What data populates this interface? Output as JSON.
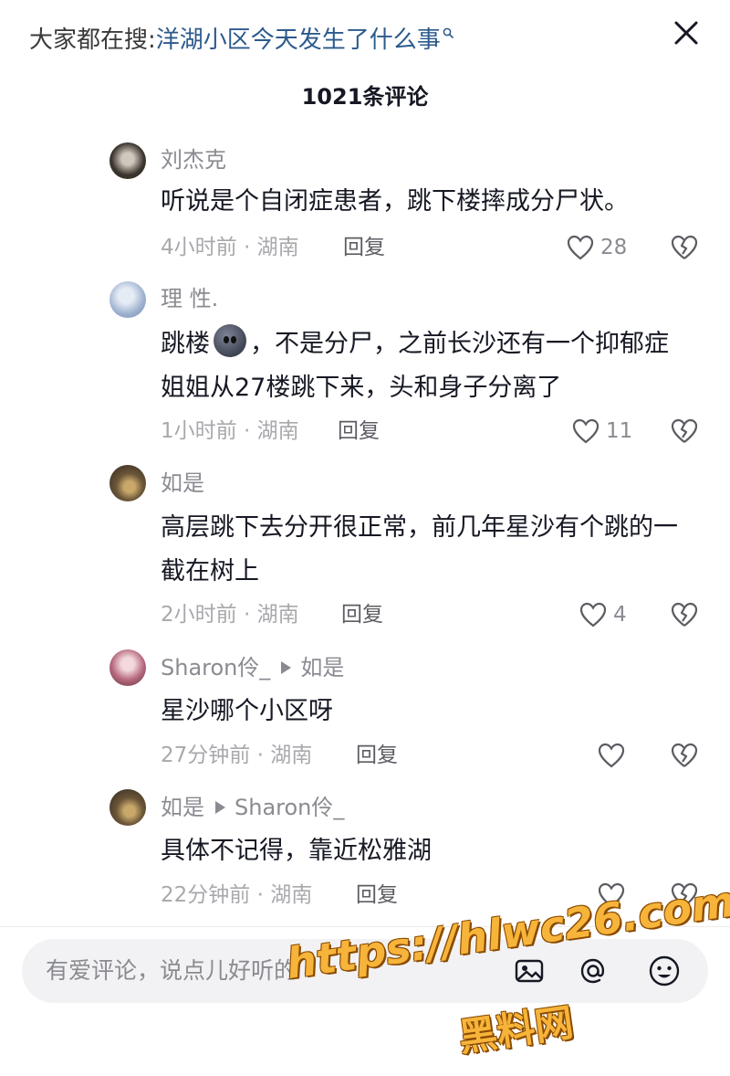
{
  "header": {
    "search_prefix": "大家都在搜:",
    "search_query": "洋湖小区今天发生了什么事",
    "comment_count": "1021条评论"
  },
  "comments": [
    {
      "user": "刘杰克",
      "text": "听说是个自闭症患者，跳下楼摔成分尸状。",
      "time_location": "4小时前 · 湖南",
      "reply_label": "回复",
      "likes": "28"
    },
    {
      "user": "理 性.",
      "text_before": "跳楼",
      "text_after": "，不是分尸，之前长沙还有一个抑郁症姐姐从27楼跳下来，头和身子分离了",
      "time_location": "1小时前 · 湖南",
      "reply_label": "回复",
      "likes": "11"
    },
    {
      "user": "如是",
      "text": "高层跳下去分开很正常，前几年星沙有个跳的一截在树上",
      "time_location": "2小时前 · 湖南",
      "reply_label": "回复",
      "likes": "4"
    },
    {
      "user": "Sharon伶_",
      "reply_to": "如是",
      "text": "星沙哪个小区呀",
      "time_location": "27分钟前 · 湖南",
      "reply_label": "回复",
      "likes": ""
    },
    {
      "user": "如是",
      "reply_to": "Sharon伶_",
      "text": "具体不记得，靠近松雅湖",
      "time_location": "22分钟前 · 湖南",
      "reply_label": "回复",
      "likes": ""
    }
  ],
  "input": {
    "placeholder": "有爱评论，说点儿好听的"
  },
  "watermark": {
    "url": "https://hlwc26.com",
    "name": "黑料网"
  },
  "colors": {
    "query": "#2c5a8c",
    "watermark": "#f7b43a"
  }
}
